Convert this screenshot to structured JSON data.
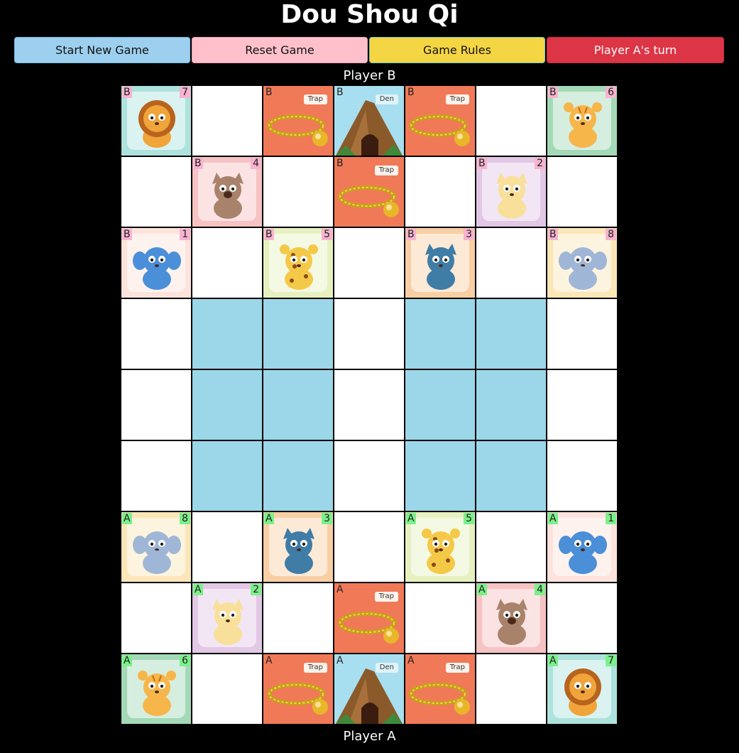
{
  "title": "Dou Shou Qi",
  "buttons": {
    "new_game": "Start New Game",
    "reset": "Reset Game",
    "rules": "Game Rules",
    "turn": "Player A's turn"
  },
  "players": {
    "top": "Player B",
    "bottom": "Player A"
  },
  "labels": {
    "trap": "Trap",
    "den": "Den"
  },
  "animal_colors": {
    "lion": "#f0a43a",
    "tiger": "#f6b64a",
    "dog": "#a8826a",
    "cat": "#f8e09a",
    "rat": "#4a8fd8",
    "leopard": "#f5c948",
    "wolf": "#3f7ca6",
    "elephant": "#9fb6d6"
  },
  "water_color": "#9bd7e8",
  "board": [
    [
      {
        "owner": "B",
        "animal": "lion",
        "rank": "7"
      },
      {
        "type": "land"
      },
      {
        "type": "trap",
        "owner": "B"
      },
      {
        "type": "den",
        "owner": "B"
      },
      {
        "type": "trap",
        "owner": "B"
      },
      {
        "type": "land"
      },
      {
        "owner": "B",
        "animal": "tiger",
        "rank": "6"
      }
    ],
    [
      {
        "type": "land"
      },
      {
        "owner": "B",
        "animal": "dog",
        "rank": "4"
      },
      {
        "type": "land"
      },
      {
        "type": "trap",
        "owner": "B"
      },
      {
        "type": "land"
      },
      {
        "owner": "B",
        "animal": "cat",
        "rank": "2"
      },
      {
        "type": "land"
      }
    ],
    [
      {
        "owner": "B",
        "animal": "rat",
        "rank": "1"
      },
      {
        "type": "land"
      },
      {
        "owner": "B",
        "animal": "leopard",
        "rank": "5"
      },
      {
        "type": "land"
      },
      {
        "owner": "B",
        "animal": "wolf",
        "rank": "3"
      },
      {
        "type": "land"
      },
      {
        "owner": "B",
        "animal": "elephant",
        "rank": "8"
      }
    ],
    [
      {
        "type": "land"
      },
      {
        "type": "water"
      },
      {
        "type": "water"
      },
      {
        "type": "land"
      },
      {
        "type": "water"
      },
      {
        "type": "water"
      },
      {
        "type": "land"
      }
    ],
    [
      {
        "type": "land"
      },
      {
        "type": "water"
      },
      {
        "type": "water"
      },
      {
        "type": "land"
      },
      {
        "type": "water"
      },
      {
        "type": "water"
      },
      {
        "type": "land"
      }
    ],
    [
      {
        "type": "land"
      },
      {
        "type": "water"
      },
      {
        "type": "water"
      },
      {
        "type": "land"
      },
      {
        "type": "water"
      },
      {
        "type": "water"
      },
      {
        "type": "land"
      }
    ],
    [
      {
        "owner": "A",
        "animal": "elephant",
        "rank": "8"
      },
      {
        "type": "land"
      },
      {
        "owner": "A",
        "animal": "wolf",
        "rank": "3"
      },
      {
        "type": "land"
      },
      {
        "owner": "A",
        "animal": "leopard",
        "rank": "5"
      },
      {
        "type": "land"
      },
      {
        "owner": "A",
        "animal": "rat",
        "rank": "1"
      }
    ],
    [
      {
        "type": "land"
      },
      {
        "owner": "A",
        "animal": "cat",
        "rank": "2"
      },
      {
        "type": "land"
      },
      {
        "type": "trap",
        "owner": "A"
      },
      {
        "type": "land"
      },
      {
        "owner": "A",
        "animal": "dog",
        "rank": "4"
      },
      {
        "type": "land"
      }
    ],
    [
      {
        "owner": "A",
        "animal": "tiger",
        "rank": "6"
      },
      {
        "type": "land"
      },
      {
        "type": "trap",
        "owner": "A"
      },
      {
        "type": "den",
        "owner": "A"
      },
      {
        "type": "trap",
        "owner": "A"
      },
      {
        "type": "land"
      },
      {
        "owner": "A",
        "animal": "lion",
        "rank": "7"
      }
    ]
  ]
}
